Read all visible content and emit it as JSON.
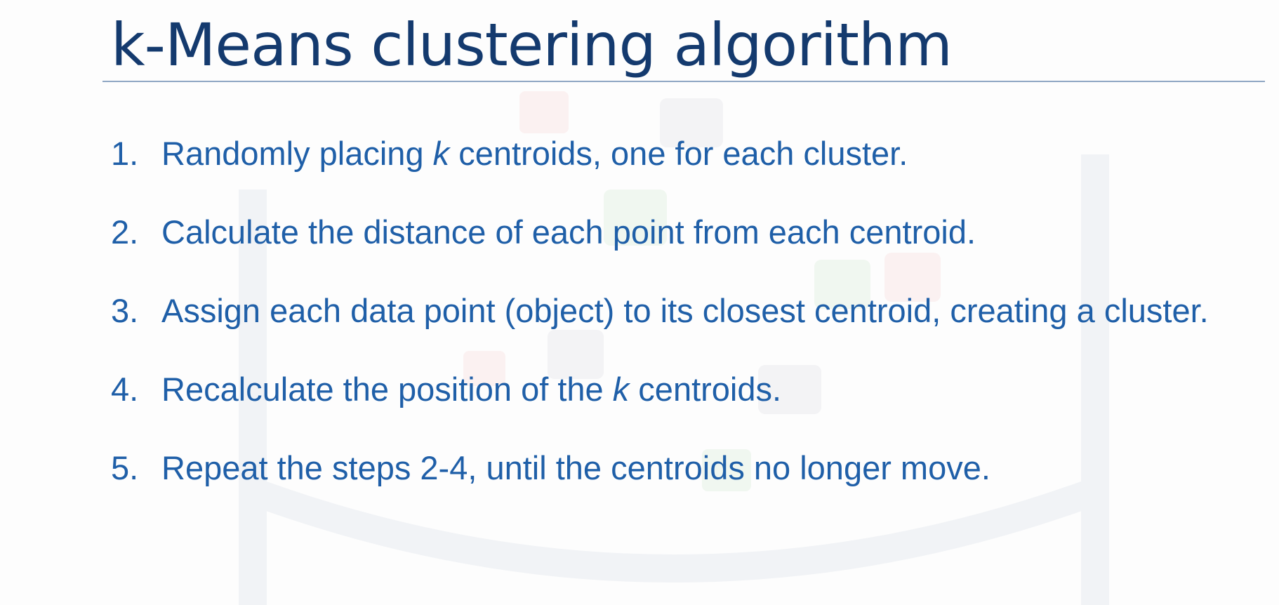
{
  "title": "k-Means clustering algorithm",
  "steps": [
    {
      "number": "1.",
      "before": "Randomly placing ",
      "var": "k",
      "after": " centroids, one for each cluster."
    },
    {
      "number": "2.",
      "before": "Calculate the distance of each point from each centroid.",
      "var": "",
      "after": ""
    },
    {
      "number": "3.",
      "before": "Assign each data point (object) to its closest centroid, creating a cluster.",
      "var": "",
      "after": ""
    },
    {
      "number": "4.",
      "before": "Recalculate the position of the ",
      "var": "k",
      "after": " centroids."
    },
    {
      "number": "5.",
      "before": "Repeat the steps 2-4, until the centroids no longer move.",
      "var": "",
      "after": ""
    }
  ],
  "colors": {
    "title": "#143a6e",
    "text": "#1f5fa8",
    "rule": "#8fa7c4"
  }
}
